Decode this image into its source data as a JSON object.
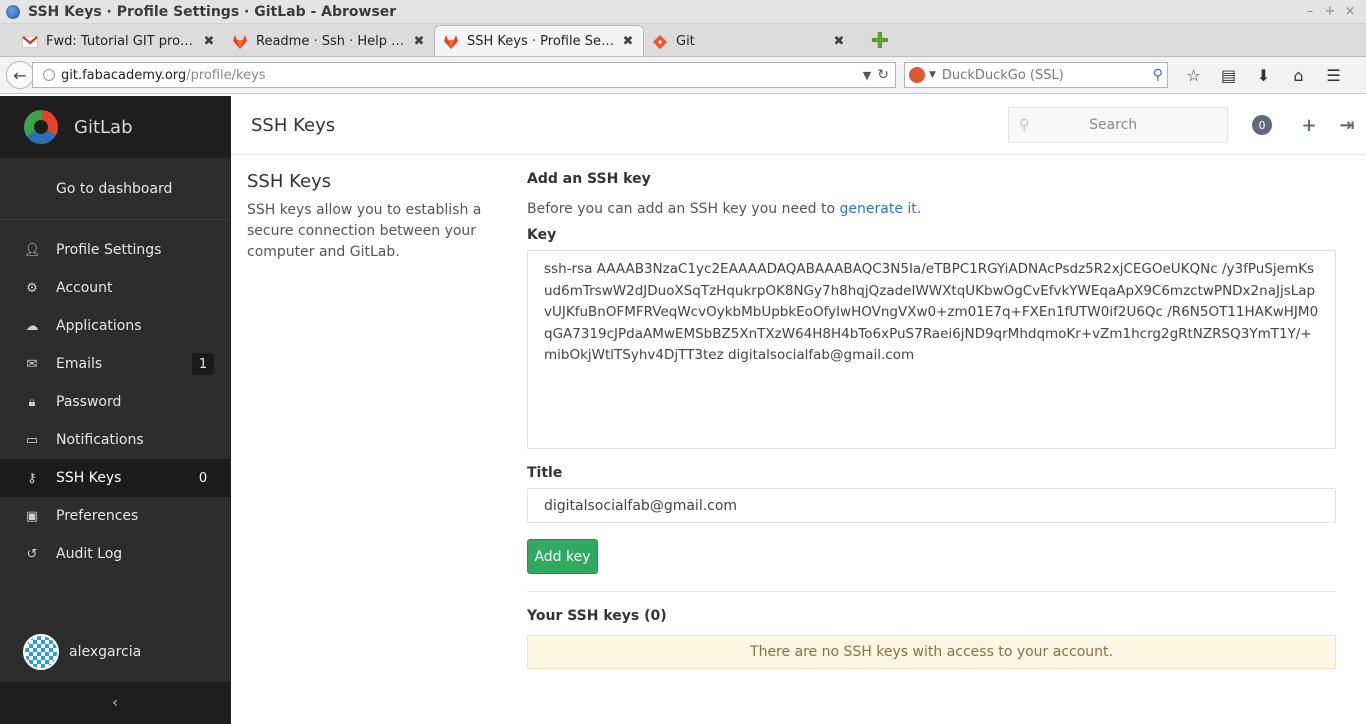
{
  "window": {
    "title": "SSH Keys · Profile Settings · GitLab - Abrowser"
  },
  "tabs": [
    {
      "label": "Fwd: Tutorial GIT pro F..."
    },
    {
      "label": "Readme · Ssh · Help · Gi..."
    },
    {
      "label": "SSH Keys · Profile Settin..."
    },
    {
      "label": "Git"
    }
  ],
  "urlbar": {
    "host": "git.fabacademy.org",
    "path": "/profile/keys"
  },
  "searchbar": {
    "placeholder": "DuckDuckGo (SSL)"
  },
  "sidebar": {
    "brand": "GitLab",
    "dashboard_link": "Go to dashboard",
    "items": [
      {
        "label": "Profile Settings",
        "icon": "user-icon",
        "count": ""
      },
      {
        "label": "Account",
        "icon": "gear-icon",
        "count": ""
      },
      {
        "label": "Applications",
        "icon": "cloud-icon",
        "count": ""
      },
      {
        "label": "Emails",
        "icon": "envelope-icon",
        "count": "1"
      },
      {
        "label": "Password",
        "icon": "lock-icon",
        "count": ""
      },
      {
        "label": "Notifications",
        "icon": "inbox-icon",
        "count": ""
      },
      {
        "label": "SSH Keys",
        "icon": "key-icon",
        "count": "0"
      },
      {
        "label": "Preferences",
        "icon": "image-icon",
        "count": ""
      },
      {
        "label": "Audit Log",
        "icon": "history-icon",
        "count": ""
      }
    ],
    "username": "alexgarcia",
    "collapse_glyph": "‹"
  },
  "header": {
    "title": "SSH Keys",
    "search_placeholder": "Search",
    "todo_count": "0"
  },
  "left": {
    "heading": "SSH Keys",
    "description": "SSH keys allow you to establish a secure connection between your computer and GitLab."
  },
  "form": {
    "heading": "Add an SSH key",
    "intro_text": "Before you can add an SSH key you need to",
    "intro_link": "generate it.",
    "key_label": "Key",
    "key_value": "ssh-rsa AAAAB3NzaC1yc2EAAAADAQABAAABAQC3N5Ia/eTBPC1RGYiADNAcPsdz5R2xjCEGOeUKQNc /y3fPuSjemKsud6mTrswW2dJDuoXSqTzHqukrpOK8NGy7h8hqjQzadeIWWXtqUKbwOgCvEfvkYWEqaApX9C6mzctwPNDx2naJjsLapvUJKfuBnOFMFRVeqWcvOykbMbUpbkEoOfyIwHOVngVXw0+zm01E7q+FXEn1fUTW0if2U6Qc /R6N5OT11HAKwHJM0qGA7319cJPdaAMwEMSbBZ5XnTXzW64H8H4bTo6xPuS7Raei6jND9qrMhdqmoKr+vZm1hcrg2gRtNZRSQ3YmT1Y/+mibOkjWtlTSyhv4DjTT3tez digitalsocialfab@gmail.com",
    "title_label": "Title",
    "title_value": "digitalsocialfab@gmail.com",
    "submit_label": "Add key"
  },
  "keys_list": {
    "heading": "Your SSH keys (0)",
    "empty_message": "There are no SSH keys with access to your account."
  },
  "colors": {
    "sidebar_bg": "#2d2d2d",
    "accent_green": "#2faa60",
    "link_blue": "#2a78c2",
    "notice_bg": "#fdf6e3"
  }
}
